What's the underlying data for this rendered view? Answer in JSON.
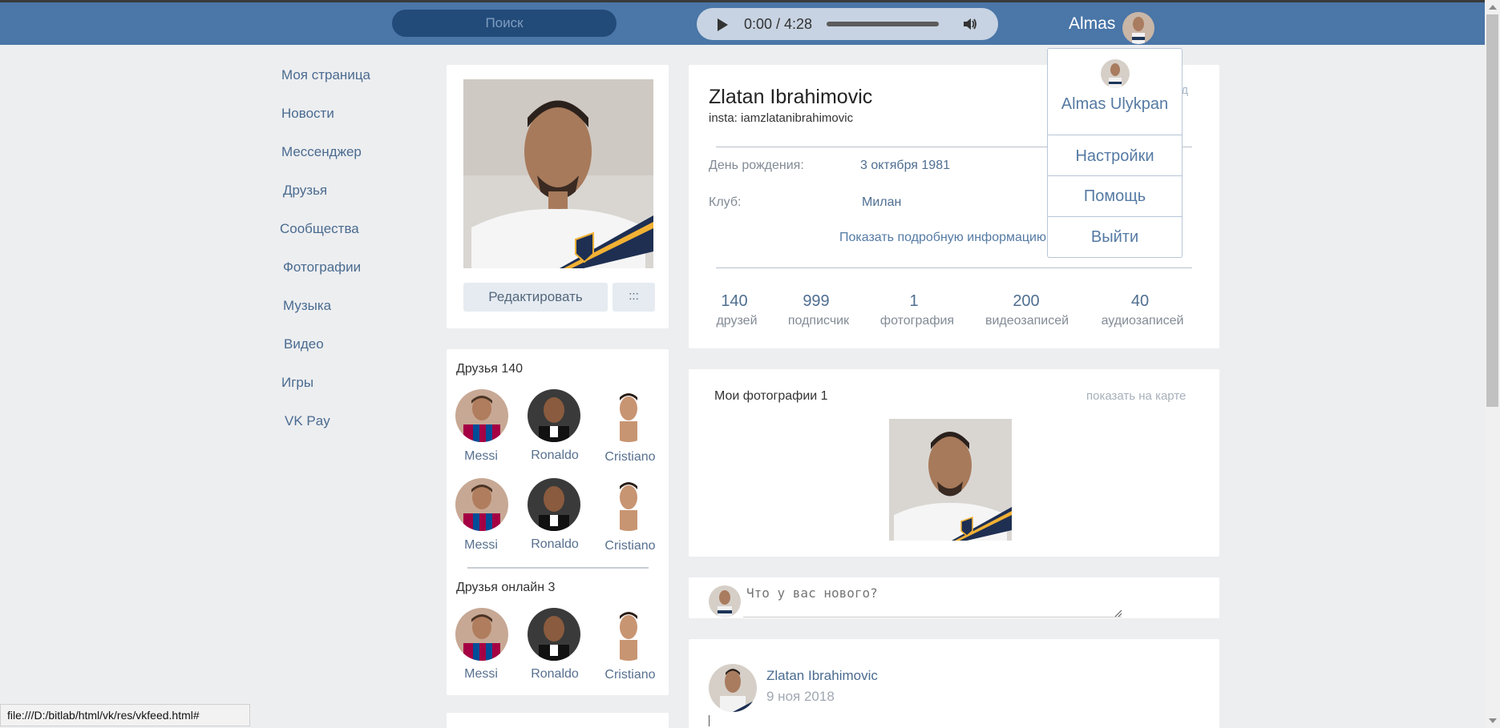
{
  "header": {
    "search_placeholder": "Поиск",
    "player_time": "0:00 / 4:28",
    "user_name": "Almas"
  },
  "dropdown": {
    "full_name": "Almas Ulykpan",
    "items": [
      "Настройки",
      "Помощь",
      "Выйти"
    ]
  },
  "menu": {
    "items": [
      "Моя страница",
      "Новости",
      "Мессенджер",
      "Друзья",
      "Сообщества",
      "Фотографии",
      "Музыка",
      "Видео",
      "Игры",
      "VK Pay"
    ]
  },
  "profile_card": {
    "edit_label": "Редактировать",
    "more_label": ":::"
  },
  "friends": {
    "title": "Друзья 140",
    "names": [
      "Messi",
      "Ronaldo",
      "Cristiano",
      "Messi",
      "Ronaldo",
      "Cristiano"
    ],
    "online_title": "Друзья онлайн 3",
    "online_names": [
      "Messi",
      "Ronaldo",
      "Cristiano"
    ]
  },
  "profile": {
    "name": "Zlatan Ibrahimovic",
    "insta": "insta: iamzlatanibrahimovic",
    "back_fragment": "зад",
    "birthday_label": "День рождения:",
    "birthday_value": "3 октября 1981",
    "club_label": "Клуб:",
    "club_value": "Милан",
    "more_info": "Показать подробную информацию",
    "counters": [
      {
        "num": "140",
        "label": "друзей"
      },
      {
        "num": "999",
        "label": "подписчик"
      },
      {
        "num": "1",
        "label": "фотография"
      },
      {
        "num": "200",
        "label": "видеозаписей"
      },
      {
        "num": "40",
        "label": "аудиозаписей"
      }
    ]
  },
  "photos": {
    "title": "Мои фотографии 1",
    "map_link": "показать на карте"
  },
  "composer": {
    "placeholder": "Что у вас нового?"
  },
  "post": {
    "author": "Zlatan Ibrahimovic",
    "date": "9 ноя 2018"
  },
  "statusbar": {
    "url": "file:///D:/bitlab/html/vk/res/vkfeed.html#"
  },
  "colors": {
    "header": "#4a76a8",
    "link": "#4a6b90",
    "page_bg": "#edeef0"
  }
}
